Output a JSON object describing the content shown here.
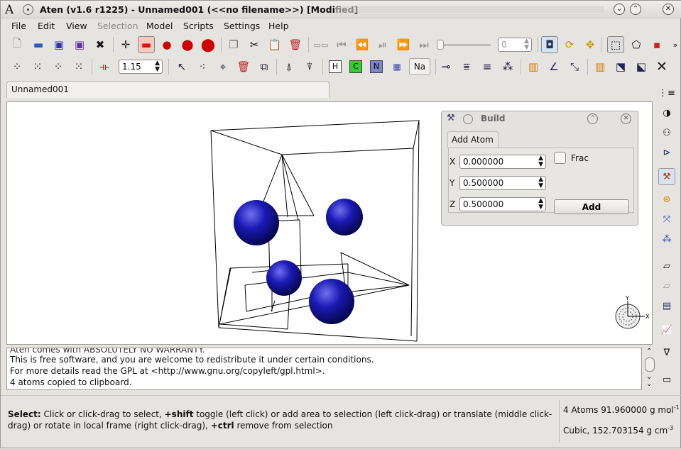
{
  "window": {
    "title": "Aten (v1.6 r1225) - Unnamed001 (<<no filename>>) [Modified]",
    "app_glyph": "A"
  },
  "menu": [
    "File",
    "Edit",
    "View",
    "Selection",
    "Model",
    "Scripts",
    "Settings",
    "Help"
  ],
  "menu_disabled": [
    "Selection"
  ],
  "toolbar1": {
    "frame_value": "0"
  },
  "toolbar2": {
    "bond_tolerance": "1.15",
    "element_buttons": [
      "H",
      "C",
      "N",
      "Na"
    ]
  },
  "tabs": [
    "Unnamed001"
  ],
  "build_window": {
    "title": "Build",
    "tab": "Add Atom",
    "x": "0.000000",
    "y": "0.500000",
    "z": "0.500000",
    "frac_label": "Frac",
    "add_label": "Add",
    "labels": {
      "x": "X",
      "y": "Y",
      "z": "Z"
    }
  },
  "log": [
    "Aten comes with ABSOLUTELY NO WARRANTY.",
    "This is free software, and you are welcome to redistribute it under certain conditions.",
    "For more details read the GPL at <http://www.gnu.org/copyleft/gpl.html>.",
    "4 atoms copied to clipboard."
  ],
  "status": {
    "help_bold1": "Select:",
    "help_text1": " Click or click-drag to select, ",
    "help_bold2": "+shift",
    "help_text2": " toggle (left click) or add area to selection (left click-drag) or translate (middle click-drag) or rotate in local frame (right click-drag), ",
    "help_bold3": "+ctrl",
    "help_text3": " remove from selection",
    "atoms_info": "4 Atoms 91.960000 g mol",
    "atoms_sup": "-1",
    "cell_info": "Cubic, 152.703154 g cm",
    "cell_sup": "-3"
  },
  "axes_labels": {
    "x": "X",
    "y": "Y"
  },
  "colors": {
    "atom": "#1a1ab4",
    "menu_disabled": "#8a8884"
  }
}
